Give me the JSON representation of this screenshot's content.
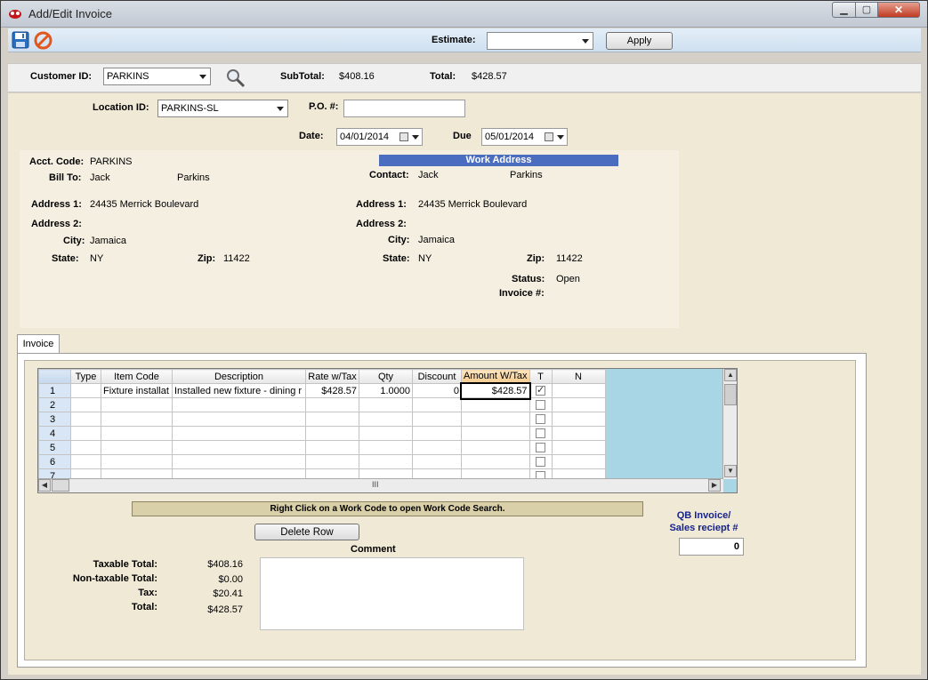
{
  "window": {
    "title": "Add/Edit Invoice",
    "min_glyph": "▁",
    "max_glyph": "▢",
    "close_glyph": "✕"
  },
  "toolbar": {
    "estimate_label": "Estimate:",
    "estimate_value": "",
    "apply_label": "Apply"
  },
  "customer": {
    "id_label": "Customer ID:",
    "id_value": "PARKINS",
    "subtotal_label": "SubTotal:",
    "subtotal_value": "$408.16",
    "total_label": "Total:",
    "total_value": "$428.57"
  },
  "header": {
    "location_label": "Location ID:",
    "location_value": "PARKINS-SL",
    "po_label": "P.O. #:",
    "po_value": "",
    "date_label": "Date:",
    "date_value": "04/01/2014",
    "due_label": "Due",
    "due_value": "05/01/2014"
  },
  "billing": {
    "acct_label": "Acct. Code:",
    "acct_value": "PARKINS",
    "billto_label": "Bill To:",
    "first_name": "Jack",
    "last_name": "Parkins",
    "addr1_label": "Address 1:",
    "addr1_value": "24435 Merrick Boulevard",
    "addr2_label": "Address 2:",
    "addr2_value": "",
    "city_label": "City:",
    "city_value": "Jamaica",
    "state_label": "State:",
    "state_value": "NY",
    "zip_label": "Zip:",
    "zip_value": "11422"
  },
  "work": {
    "header": "Work Address",
    "contact_label": "Contact:",
    "first_name": "Jack",
    "last_name": "Parkins",
    "addr1_label": "Address 1:",
    "addr1_value": "24435 Merrick Boulevard",
    "addr2_label": "Address 2:",
    "addr2_value": "",
    "city_label": "City:",
    "city_value": "Jamaica",
    "state_label": "State:",
    "state_value": "NY",
    "zip_label": "Zip:",
    "zip_value": "11422",
    "status_label": "Status:",
    "status_value": "Open",
    "invoice_label": "Invoice #:",
    "invoice_value": ""
  },
  "tabs": [
    {
      "label": "Invoice",
      "active": true
    }
  ],
  "grid": {
    "columns": [
      "Type",
      "Item Code",
      "Description",
      "Rate w/Tax",
      "Qty",
      "Discount",
      "Amount W/Tax",
      "T",
      "N"
    ],
    "rows": [
      {
        "num": "1",
        "type": "",
        "item_code": "Fixture installat",
        "description": "Installed new fixture - dining r",
        "rate": "$428.57",
        "qty": "1.0000",
        "discount": "0",
        "amount": "$428.57",
        "taxed": true,
        "n": ""
      },
      {
        "num": "2",
        "type": "",
        "item_code": "",
        "description": "",
        "rate": "",
        "qty": "",
        "discount": "",
        "amount": "",
        "taxed": false,
        "n": ""
      },
      {
        "num": "3",
        "type": "",
        "item_code": "",
        "description": "",
        "rate": "",
        "qty": "",
        "discount": "",
        "amount": "",
        "taxed": false,
        "n": ""
      },
      {
        "num": "4",
        "type": "",
        "item_code": "",
        "description": "",
        "rate": "",
        "qty": "",
        "discount": "",
        "amount": "",
        "taxed": false,
        "n": ""
      },
      {
        "num": "5",
        "type": "",
        "item_code": "",
        "description": "",
        "rate": "",
        "qty": "",
        "discount": "",
        "amount": "",
        "taxed": false,
        "n": ""
      },
      {
        "num": "6",
        "type": "",
        "item_code": "",
        "description": "",
        "rate": "",
        "qty": "",
        "discount": "",
        "amount": "",
        "taxed": false,
        "n": ""
      },
      {
        "num": "7",
        "type": "",
        "item_code": "",
        "description": "",
        "rate": "",
        "qty": "",
        "discount": "",
        "amount": "",
        "taxed": false,
        "n": ""
      }
    ],
    "hscroll_grip": "III"
  },
  "footer": {
    "hint": "Right Click on a Work Code to open Work Code Search.",
    "qb_label_line1": "QB Invoice/",
    "qb_label_line2": "Sales reciept #",
    "qb_value": "0",
    "delete_row_label": "Delete Row",
    "comment_label": "Comment",
    "comment_value": "",
    "taxable_label": "Taxable Total:",
    "taxable_value": "$408.16",
    "nontaxable_label": "Non-taxable Total:",
    "nontaxable_value": "$0.00",
    "tax_label": "Tax:",
    "tax_value": "$20.41",
    "total_label": "Total:",
    "total_value": "$428.57"
  }
}
